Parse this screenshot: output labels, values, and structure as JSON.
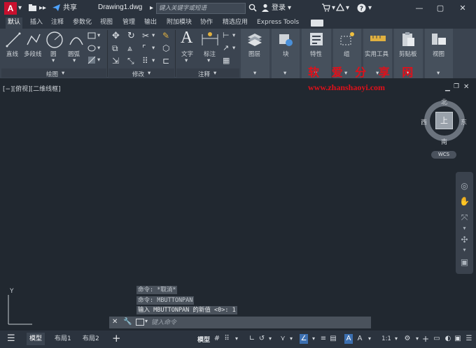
{
  "titlebar": {
    "logo": "A",
    "share_label": "共享",
    "document_title": "Drawing1.dwg",
    "search_placeholder": "键入关键字或短语",
    "login_label": "登录"
  },
  "tabs": [
    {
      "label": "默认",
      "active": true
    },
    {
      "label": "插入"
    },
    {
      "label": "注释"
    },
    {
      "label": "参数化"
    },
    {
      "label": "视图"
    },
    {
      "label": "管理"
    },
    {
      "label": "输出"
    },
    {
      "label": "附加模块"
    },
    {
      "label": "协作"
    },
    {
      "label": "精选应用"
    },
    {
      "label": "Express Tools"
    }
  ],
  "ribbon": {
    "draw": {
      "line": "直线",
      "polyline": "多段线",
      "circle": "圆",
      "arc": "圆弧",
      "panel_label": "绘图"
    },
    "modify": {
      "panel_label": "修改"
    },
    "annotation": {
      "text": "文字",
      "dimension": "标注",
      "panel_label": "注释"
    },
    "layers": "图层",
    "block": "块",
    "properties": "特性",
    "groups": "组",
    "utilities": "实用工具",
    "clipboard": "剪贴板",
    "view": "视图"
  },
  "viewport": {
    "label": "[−][俯视][二维线框]"
  },
  "watermark": {
    "cn": "软 爱 分 享 网",
    "url": "www.zhanshaoyi.com"
  },
  "viewcube": {
    "north": "北",
    "south": "南",
    "east": "东",
    "west": "西",
    "top": "上",
    "wcs": "WCS"
  },
  "ucs": {
    "y_label": "Y"
  },
  "command": {
    "history": [
      "命令: *取消*",
      "命令: MBUTTONPAN",
      "输入 MBUTTONPAN 的新值 <0>: 1"
    ],
    "input_placeholder": "键入命令"
  },
  "statusbar": {
    "tabs": [
      {
        "label": "模型",
        "active": true
      },
      {
        "label": "布局1"
      },
      {
        "label": "布局2"
      }
    ],
    "model_label": "模型",
    "scale_label": "1:1"
  }
}
